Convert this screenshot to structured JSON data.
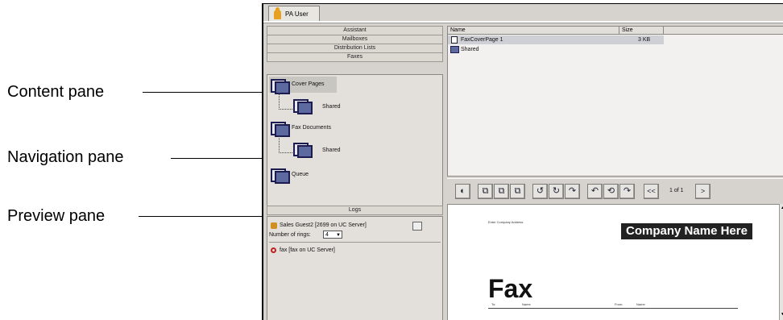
{
  "window": {
    "tab_label": "PA User"
  },
  "left_pane": {
    "categories": [
      "Assistant",
      "Mailboxes",
      "Distribution Lists",
      "Faxes"
    ],
    "nav_items": [
      {
        "label": "Cover Pages"
      },
      {
        "label": "Shared"
      },
      {
        "label": "Fax Documents"
      },
      {
        "label": "Shared"
      },
      {
        "label": "Queue"
      }
    ],
    "logs_label": "Logs",
    "contact": {
      "name": "Sales Guest2 [2699 on UC Server]",
      "rings_label": "Number of rings:",
      "rings_value": "4"
    },
    "fax_line": "fax [fax on UC Server]"
  },
  "content_pane": {
    "columns": [
      "Name",
      "Size"
    ],
    "rows": [
      {
        "name": "FaxCoverPage 1",
        "size": "3 KB"
      },
      {
        "name": "Shared",
        "size": ""
      }
    ]
  },
  "preview": {
    "page_indicator": "1 of 1",
    "prev_label": "<<",
    "next_label": ">",
    "company_address": "Enter Company Address",
    "company_name": "Company Name Here",
    "fax_title": "Fax",
    "field_to": "To:",
    "field_to_value": "Name",
    "field_from": "From:",
    "field_from_value": "Name"
  },
  "annotations": {
    "content_pane": "Content pane",
    "navigation_pane": "Navigation pane",
    "preview_pane": "Preview pane"
  }
}
